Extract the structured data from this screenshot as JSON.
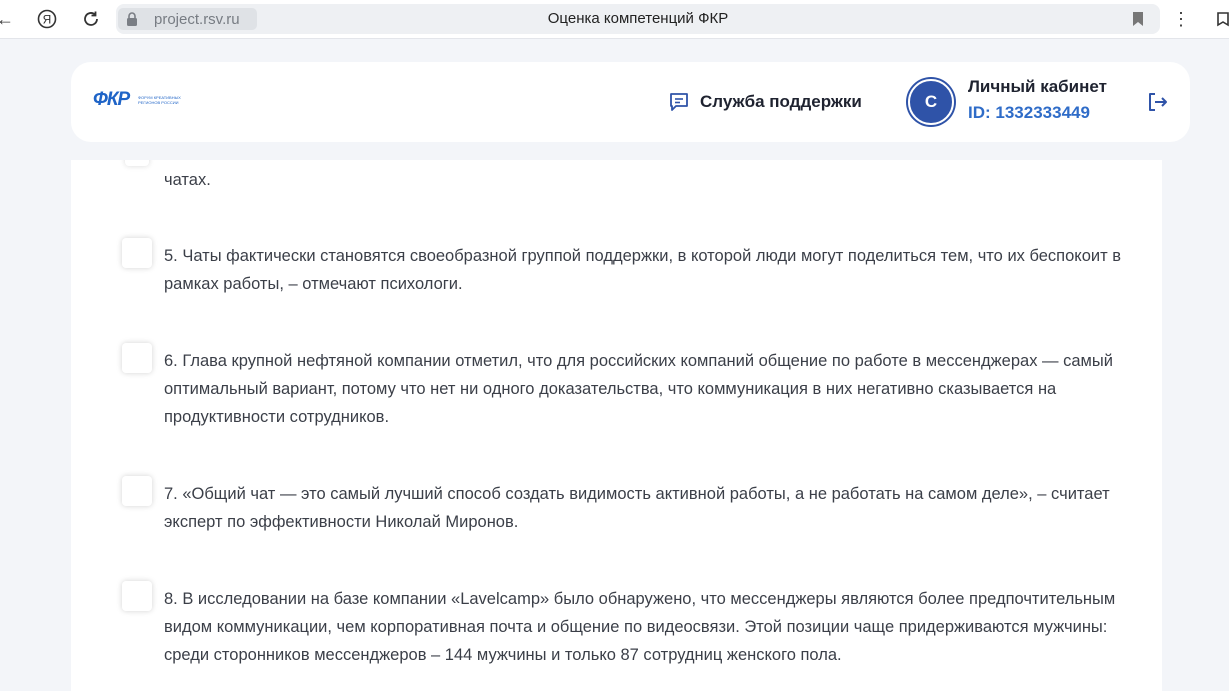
{
  "browser": {
    "url": "project.rsv.ru",
    "title": "Оценка компетенций ФКР"
  },
  "header": {
    "logo_text": "ФКР",
    "logo_subtext": "ФОРУМ КРЕАТИВНЫХ РЕГИОНОВ РОССИИ",
    "support_label": "Служба поддержки",
    "avatar_letter": "С",
    "account_title": "Личный кабинет",
    "account_id": "ID: 1332333449"
  },
  "content": {
    "top_fragment": "чатах.",
    "items": [
      {
        "text": "5. Чаты фактически становятся своеобразной группой поддержки, в которой люди могут поделиться тем, что их беспокоит в рамках работы, – отмечают психологи."
      },
      {
        "text": "6. Глава крупной нефтяной компании отметил, что для российских компаний общение по работе в мессенджерах — самый оптимальный вариант, потому что нет ни одного доказательства, что коммуникация в них негативно сказывается на продуктивности сотрудников."
      },
      {
        "text": "7. «Общий чат — это самый лучший способ создать видимость активной работы, а не работать на самом деле», – считает эксперт по эффективности Николай Миронов."
      },
      {
        "text": "8. В исследовании на базе компании «Lavelcamp» было обнаружено, что мессенджеры являются более предпочтительным видом коммуникации, чем корпоративная почта и общение по видеосвязи. Этой позиции чаще придерживаются мужчины: среди сторонников мессенджеров – 144 мужчины и только 87 сотрудниц женского пола."
      }
    ]
  },
  "colors": {
    "accent": "#2f6cc8",
    "avatar_bg": "#2f53a8",
    "page_bg": "#f3f5f9"
  }
}
